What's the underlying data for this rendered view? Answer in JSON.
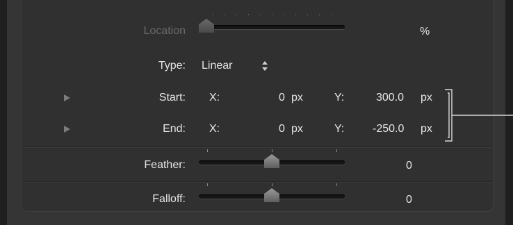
{
  "location": {
    "label": "Location",
    "unit": "%",
    "value": 0
  },
  "type": {
    "label": "Type:",
    "value": "Linear"
  },
  "start": {
    "label": "Start:",
    "x_label": "X:",
    "x_value": "0",
    "x_unit": "px",
    "y_label": "Y:",
    "y_value": "300.0",
    "y_unit": "px"
  },
  "end": {
    "label": "End:",
    "x_label": "X:",
    "x_value": "0",
    "x_unit": "px",
    "y_label": "Y:",
    "y_value": "-250.0",
    "y_unit": "px"
  },
  "feather": {
    "label": "Feather:",
    "value": "0",
    "level": 0.5
  },
  "falloff": {
    "label": "Falloff:",
    "value": "0",
    "level": 0.5
  },
  "colors": {
    "background": "#303030",
    "text": "#e6e6e6",
    "dim_text": "#6a6a6a"
  }
}
